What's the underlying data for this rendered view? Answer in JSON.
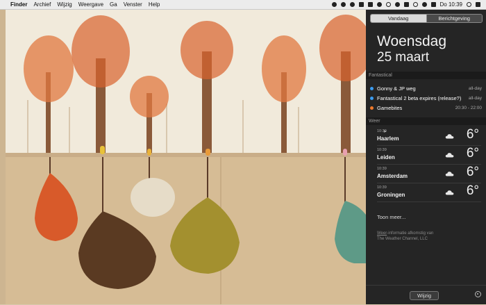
{
  "menubar": {
    "apple_symbol": "",
    "app_name": "Finder",
    "menus": [
      "Archief",
      "Wijzig",
      "Weergave",
      "Ga",
      "Venster",
      "Help"
    ],
    "status_icons": [
      "dropbox-icon",
      "bear-icon",
      "message-icon",
      "notes-icon",
      "box-icon",
      "clock-icon",
      "sync-icon",
      "info-icon",
      "bluetooth-icon",
      "wifi-icon",
      "sound-icon",
      "battery-icon"
    ],
    "clock": "Do 10:39",
    "search_icon": "search-icon",
    "list_icon": "notification-center-icon"
  },
  "notification_center": {
    "tabs": [
      {
        "label": "Vandaag",
        "active": true
      },
      {
        "label": "Berichtgeving",
        "active": false
      }
    ],
    "day": "Woensdag",
    "date": "25 maart",
    "fantastical": {
      "header": "Fantastical",
      "events": [
        {
          "title": "Gonny & JP weg",
          "time": "all-day",
          "color": "#3b9cf0"
        },
        {
          "title": "Fantastical 2 beta expires (release?)",
          "time": "all-day",
          "color": "#3b9cf0"
        },
        {
          "title": "Gamebites",
          "time": "20:30 - 22:00",
          "color": "#f07a2b"
        }
      ]
    },
    "weather": {
      "header": "Weer",
      "rows": [
        {
          "time": "10:39",
          "location_arrow": "➤",
          "city": "Haarlem",
          "temp": "6°",
          "icon": "cloud-icon"
        },
        {
          "time": "10:39",
          "location_arrow": "",
          "city": "Leiden",
          "temp": "6°",
          "icon": "cloud-icon"
        },
        {
          "time": "10:39",
          "location_arrow": "",
          "city": "Amsterdam",
          "temp": "6°",
          "icon": "cloud-icon"
        },
        {
          "time": "10:39",
          "location_arrow": "",
          "city": "Groningen",
          "temp": "6°",
          "icon": "cloud-icon"
        }
      ],
      "more": "Toon meer...",
      "credit_link": "Weer",
      "credit_line1": "-informatie afkomstig van",
      "credit_line2": "The Weather Channel, LLC"
    },
    "footer": {
      "edit_button": "Wijzig",
      "settings_icon": "gear-icon"
    }
  },
  "colors": {
    "accent_blue": "#3b9cf0",
    "accent_orange": "#f07a2b",
    "panel_bg": "#252525",
    "sky": "#f1eadb",
    "ground": "#d6bc95",
    "leaf": "#d8622d"
  }
}
